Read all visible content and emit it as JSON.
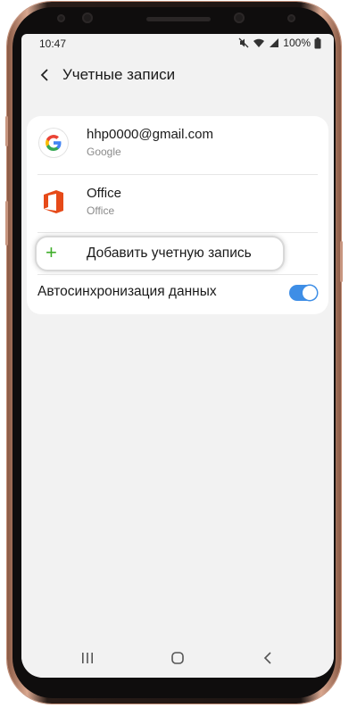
{
  "status_bar": {
    "time": "10:47",
    "battery": "100%"
  },
  "header": {
    "title": "Учетные записи"
  },
  "accounts": [
    {
      "name": "hhp0000@gmail.com",
      "type": "Google",
      "icon": "google-icon"
    },
    {
      "name": "Office",
      "type": "Office",
      "icon": "office-icon"
    }
  ],
  "add_account": {
    "label": "Добавить учетную запись",
    "icon": "plus-icon"
  },
  "auto_sync": {
    "label": "Автосинхронизация данных",
    "enabled": true
  },
  "nav": {
    "recents_icon": "recents-icon",
    "home_icon": "home-icon",
    "back_icon": "back-icon"
  },
  "colors": {
    "accent": "#3e8ee6",
    "plus": "#3fae2a",
    "office": "#e64a19"
  }
}
